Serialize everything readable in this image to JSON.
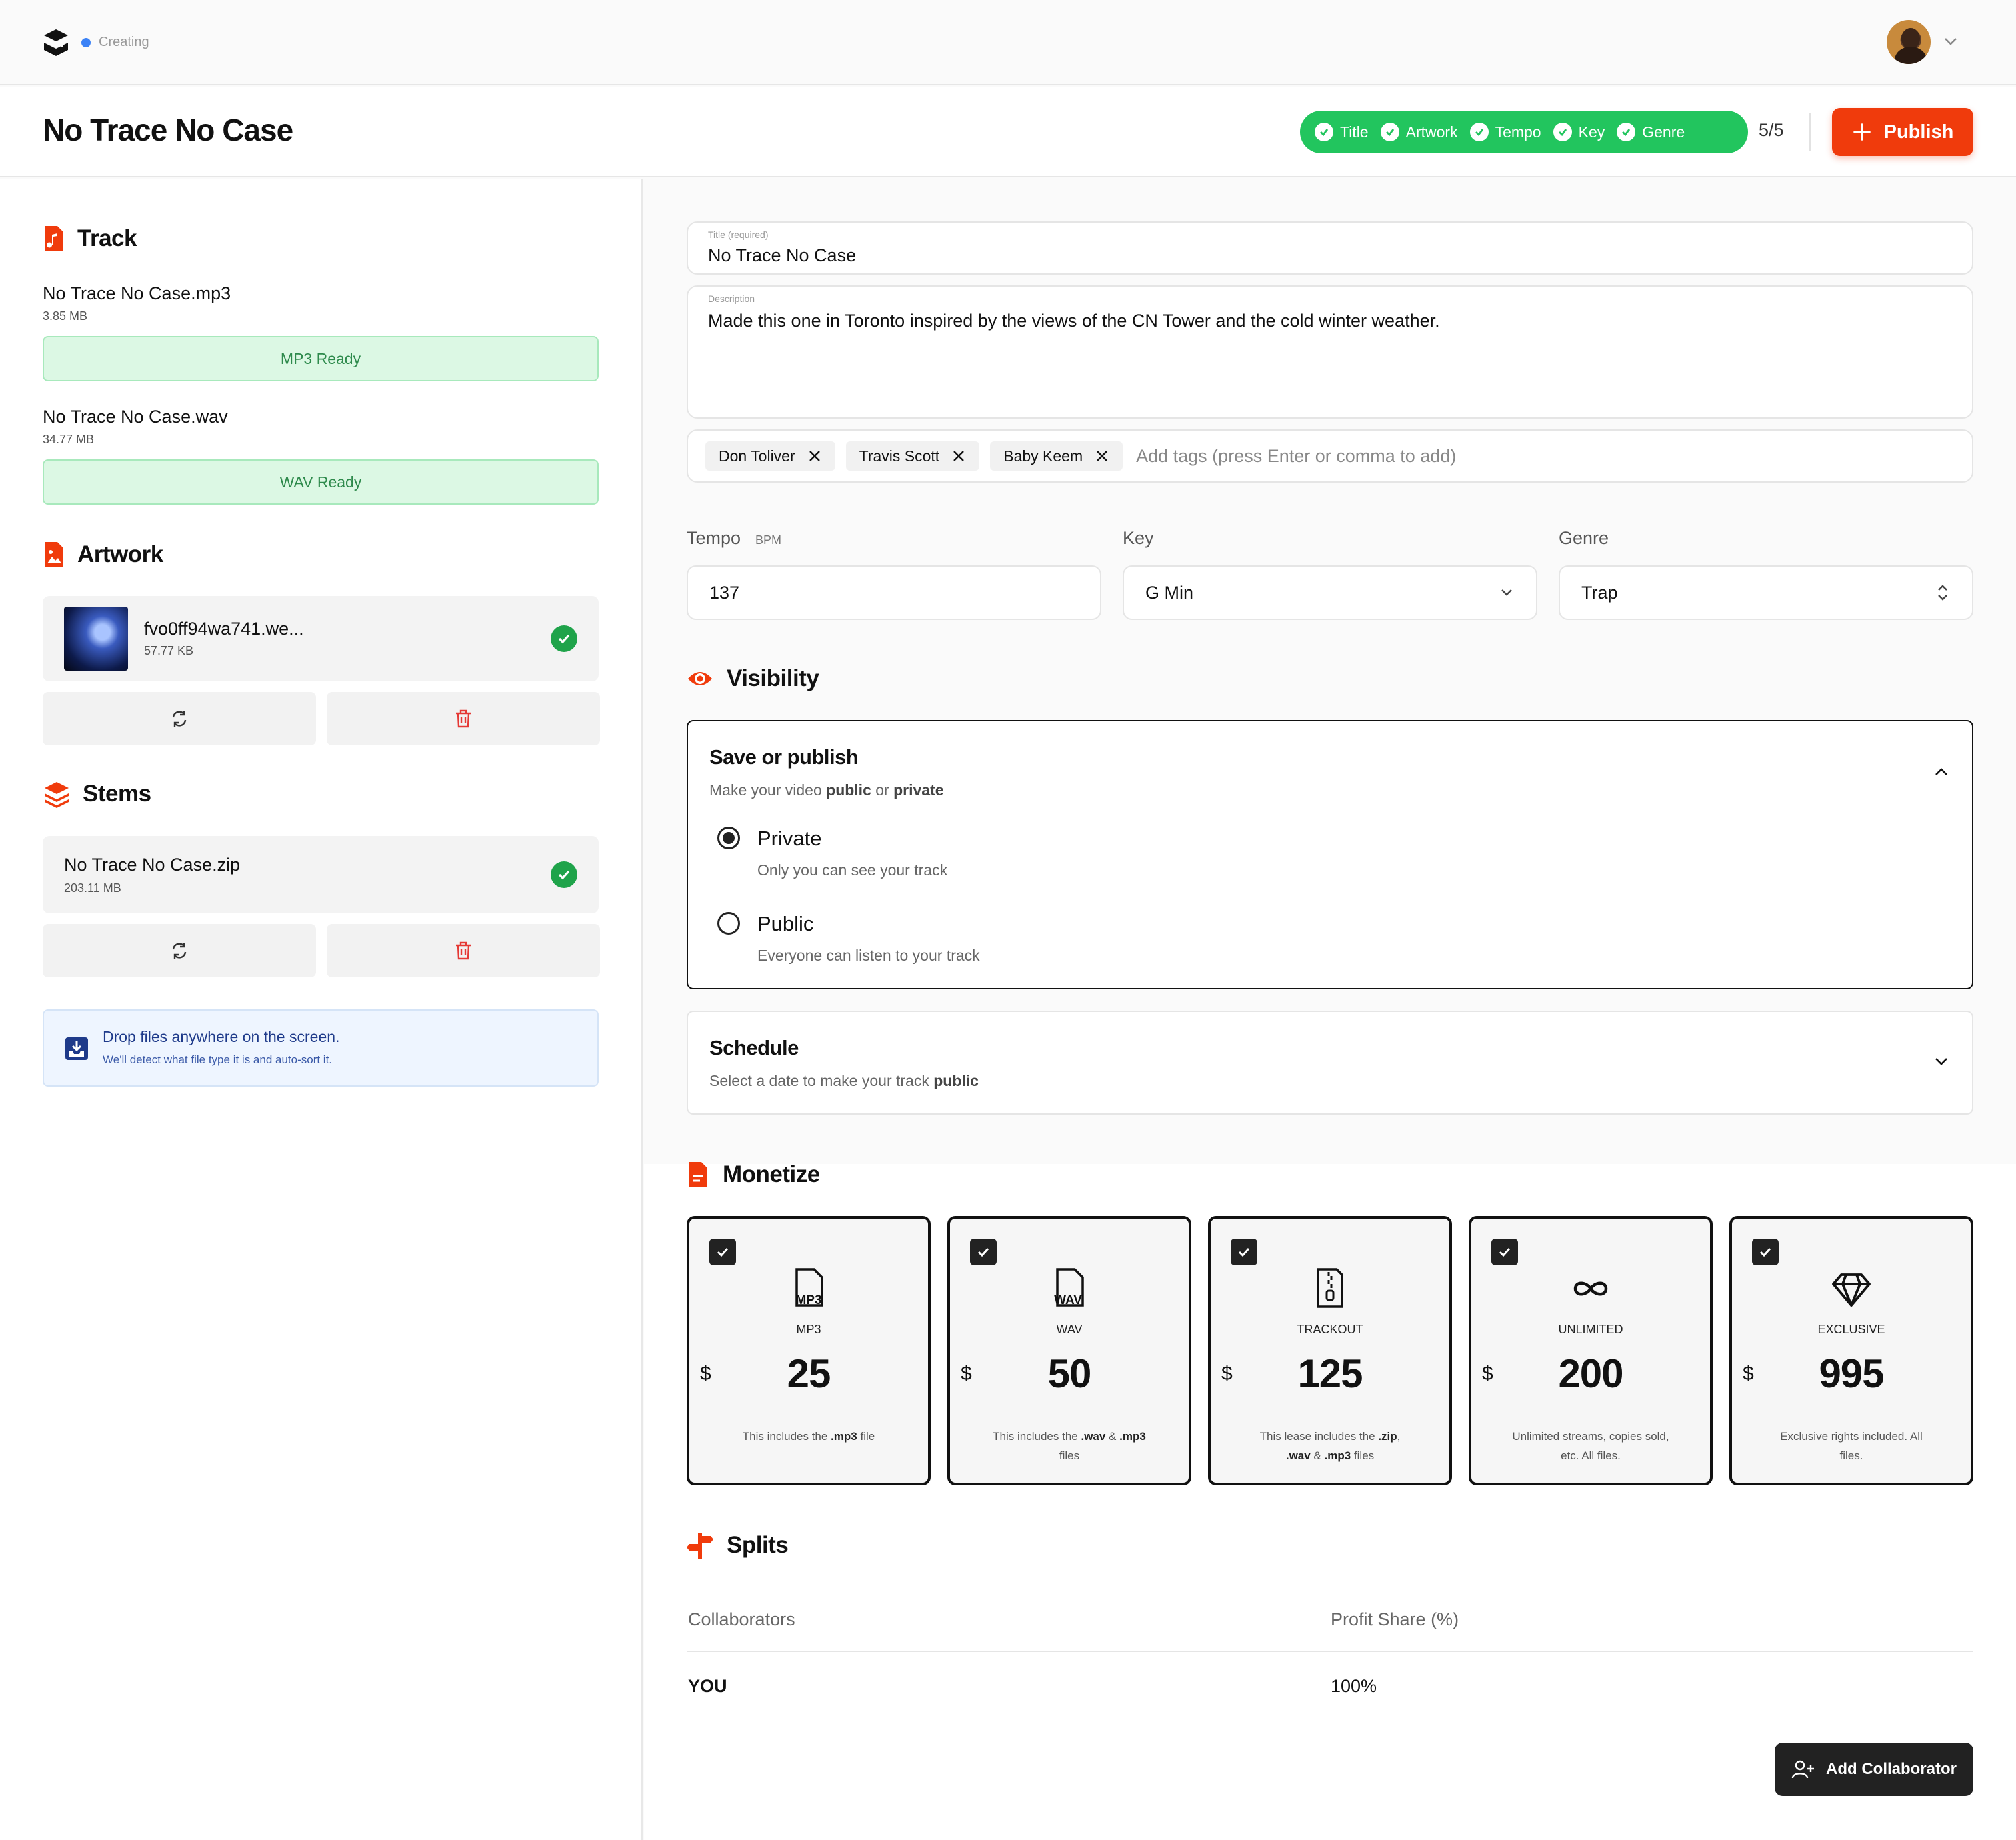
{
  "status": {
    "label": "Creating",
    "dot_color": "#3b82f6"
  },
  "track_title": "No Trace No Case",
  "progress": {
    "items": [
      "Title",
      "Artwork",
      "Tempo",
      "Key",
      "Genre"
    ],
    "count": "5/5",
    "color": "#22c55e"
  },
  "publish_label": "Publish",
  "accent_color": "#f03b0c",
  "sections": {
    "track": "Track",
    "artwork": "Artwork",
    "stems": "Stems",
    "visibility": "Visibility",
    "monetize": "Monetize",
    "splits": "Splits"
  },
  "track_files": [
    {
      "name": "No Trace No Case.mp3",
      "size": "3.85 MB",
      "status": "MP3 Ready"
    },
    {
      "name": "No Trace No Case.wav",
      "size": "34.77 MB",
      "status": "WAV Ready"
    }
  ],
  "artwork_file": {
    "name": "fvo0ff94wa741.we...",
    "size": "57.77 KB"
  },
  "stems_file": {
    "name": "No Trace No Case.zip",
    "size": "203.11 MB"
  },
  "dropzone": {
    "title": "Drop files anywhere on the screen.",
    "subtitle": "We'll detect what file type it is and auto-sort it."
  },
  "form": {
    "title_label": "Title (required)",
    "title_value": "No Trace No Case",
    "description_label": "Description",
    "description_value": "Made this one in Toronto inspired by the views of the CN Tower and the cold winter weather.",
    "tags": [
      "Don Toliver",
      "Travis Scott",
      "Baby Keem"
    ],
    "tags_placeholder": "Add tags (press Enter or comma to add)",
    "tempo_label": "Tempo",
    "tempo_unit": "BPM",
    "tempo_value": "137",
    "key_label": "Key",
    "key_value": "G Min",
    "genre_label": "Genre",
    "genre_value": "Trap"
  },
  "visibility": {
    "title": "Save or publish",
    "subtitle_pre": "Make your video ",
    "subtitle_public": "public",
    "subtitle_or": " or ",
    "subtitle_private": "private",
    "options": [
      {
        "label": "Private",
        "desc": "Only you can see your track",
        "selected": true
      },
      {
        "label": "Public",
        "desc": "Everyone can listen to your track",
        "selected": false
      }
    ]
  },
  "schedule": {
    "title": "Schedule",
    "subtitle_pre": "Select a date to make your track ",
    "subtitle_bold": "public"
  },
  "licenses": [
    {
      "icon": "mp3-file-icon",
      "icon_text": "MP3",
      "name": "MP3",
      "currency": "$",
      "price": "25",
      "desc_html": "This includes the <b>.mp3</b> file"
    },
    {
      "icon": "wav-file-icon",
      "icon_text": "WAV",
      "name": "WAV",
      "currency": "$",
      "price": "50",
      "desc_html": "This includes the <b>.wav</b> &amp; <b>.mp3</b> files"
    },
    {
      "icon": "zip-file-icon",
      "icon_text": "",
      "name": "TRACKOUT",
      "currency": "$",
      "price": "125",
      "desc_html": "This lease includes the <b>.zip</b>, <b>.wav</b> &amp; <b>.mp3</b> files"
    },
    {
      "icon": "infinity-icon",
      "icon_text": "",
      "name": "UNLIMITED",
      "currency": "$",
      "price": "200",
      "desc_html": "Unlimited streams, copies sold, etc. All files."
    },
    {
      "icon": "diamond-icon",
      "icon_text": "",
      "name": "EXCLUSIVE",
      "currency": "$",
      "price": "995",
      "desc_html": "Exclusive rights included. All files."
    }
  ],
  "splits": {
    "col_collaborators": "Collaborators",
    "col_share": "Profit Share (%)",
    "rows": [
      {
        "name": "YOU",
        "share": "100%"
      }
    ],
    "add_label": "Add Collaborator"
  }
}
